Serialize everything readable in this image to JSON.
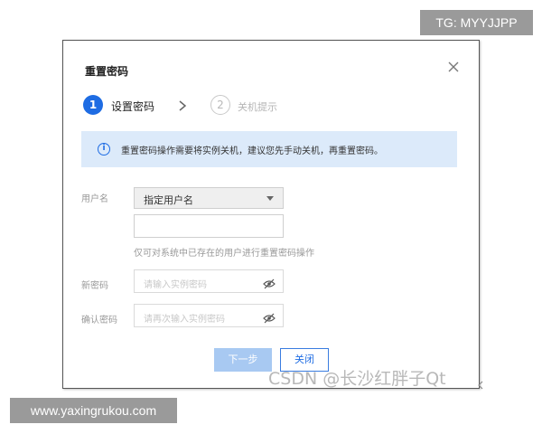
{
  "overlay": {
    "tg_badge": "TG: MYYJJPP",
    "site_badge": "www.yaxingrukou.com",
    "csdn_watermark": "CSDN @长沙红胖子Qt"
  },
  "dialog": {
    "title": "重置密码",
    "close_icon": "close-icon",
    "steps": [
      {
        "number": "1",
        "label": "设置密码",
        "state": "active"
      },
      {
        "number": "2",
        "label": "关机提示",
        "state": "inactive"
      }
    ],
    "notice": {
      "icon": "info-icon",
      "icon_glyph": "i",
      "text": "重置密码操作需要将实例关机，建议您先手动关机，再重置密码。"
    },
    "form": {
      "username_label": "用户名",
      "username_select_value": "指定用户名",
      "username_input_value": "",
      "username_hint": "仅可对系统中已存在的用户进行重置密码操作",
      "new_password_label": "新密码",
      "new_password_placeholder": "请输入实例密码",
      "confirm_password_label": "确认密码",
      "confirm_password_placeholder": "请再次输入实例密码"
    },
    "buttons": {
      "next": "下一步",
      "close": "关闭"
    }
  },
  "colors": {
    "accent": "#1e6ce3",
    "notice_bg": "#dceafa",
    "disabled_button": "#a8c9f2"
  }
}
